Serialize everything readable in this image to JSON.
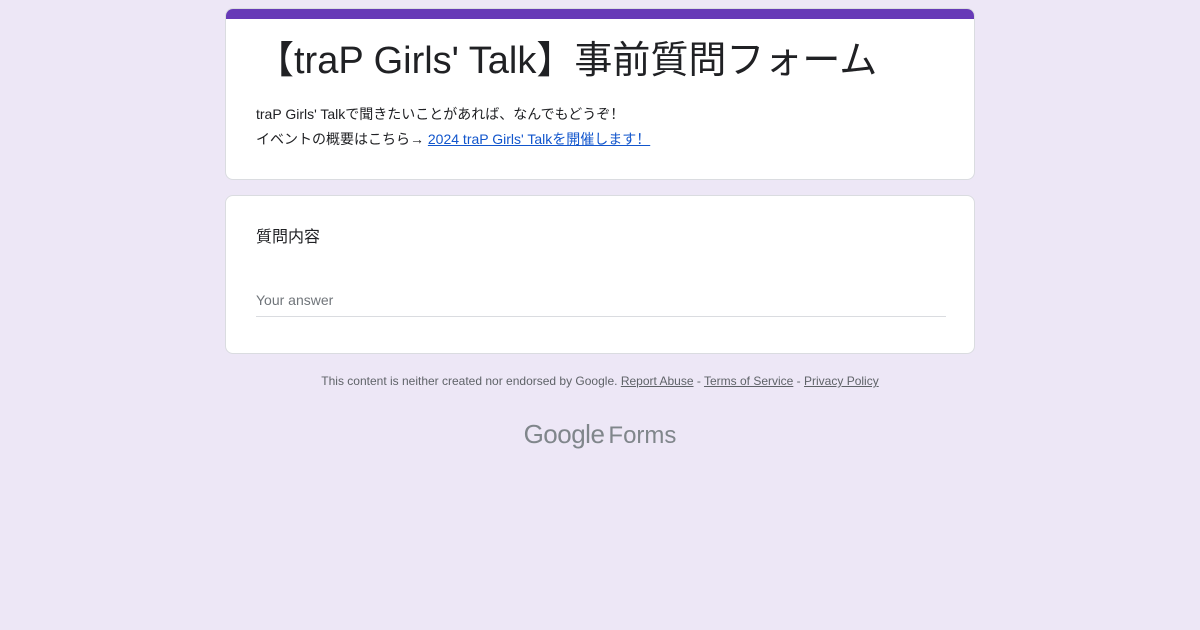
{
  "header": {
    "title": "【traP Girls' Talk】事前質問フォーム",
    "description_line1": "traP Girls' Talkで聞きたいことがあれば、なんでもどうぞ！",
    "description_line2_prefix": "イベントの概要はこちら→ ",
    "description_link": "2024 traP Girls' Talkを開催します！",
    "accent_color": "#673ab7"
  },
  "question": {
    "title": "質問内容",
    "answer_placeholder": "Your answer",
    "answer_value": ""
  },
  "footer": {
    "notice": "This content is neither created nor endorsed by Google.",
    "report_abuse": "Report Abuse",
    "separator1": " - ",
    "terms": "Terms of Service",
    "separator2": " - ",
    "privacy": "Privacy Policy"
  },
  "brand": {
    "google": "Google",
    "forms": "Forms"
  },
  "colors": {
    "page_background": "#ede7f6",
    "link": "#1155cc"
  }
}
